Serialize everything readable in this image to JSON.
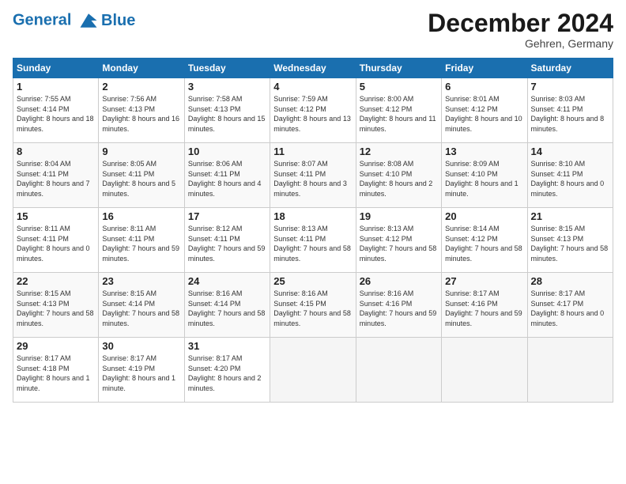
{
  "header": {
    "logo_line1": "General",
    "logo_line2": "Blue",
    "month": "December 2024",
    "location": "Gehren, Germany"
  },
  "days_of_week": [
    "Sunday",
    "Monday",
    "Tuesday",
    "Wednesday",
    "Thursday",
    "Friday",
    "Saturday"
  ],
  "weeks": [
    [
      {
        "day": 1,
        "sunrise": "7:55 AM",
        "sunset": "4:14 PM",
        "daylight": "8 hours and 18 minutes."
      },
      {
        "day": 2,
        "sunrise": "7:56 AM",
        "sunset": "4:13 PM",
        "daylight": "8 hours and 16 minutes."
      },
      {
        "day": 3,
        "sunrise": "7:58 AM",
        "sunset": "4:13 PM",
        "daylight": "8 hours and 15 minutes."
      },
      {
        "day": 4,
        "sunrise": "7:59 AM",
        "sunset": "4:12 PM",
        "daylight": "8 hours and 13 minutes."
      },
      {
        "day": 5,
        "sunrise": "8:00 AM",
        "sunset": "4:12 PM",
        "daylight": "8 hours and 11 minutes."
      },
      {
        "day": 6,
        "sunrise": "8:01 AM",
        "sunset": "4:12 PM",
        "daylight": "8 hours and 10 minutes."
      },
      {
        "day": 7,
        "sunrise": "8:03 AM",
        "sunset": "4:11 PM",
        "daylight": "8 hours and 8 minutes."
      }
    ],
    [
      {
        "day": 8,
        "sunrise": "8:04 AM",
        "sunset": "4:11 PM",
        "daylight": "8 hours and 7 minutes."
      },
      {
        "day": 9,
        "sunrise": "8:05 AM",
        "sunset": "4:11 PM",
        "daylight": "8 hours and 5 minutes."
      },
      {
        "day": 10,
        "sunrise": "8:06 AM",
        "sunset": "4:11 PM",
        "daylight": "8 hours and 4 minutes."
      },
      {
        "day": 11,
        "sunrise": "8:07 AM",
        "sunset": "4:11 PM",
        "daylight": "8 hours and 3 minutes."
      },
      {
        "day": 12,
        "sunrise": "8:08 AM",
        "sunset": "4:10 PM",
        "daylight": "8 hours and 2 minutes."
      },
      {
        "day": 13,
        "sunrise": "8:09 AM",
        "sunset": "4:10 PM",
        "daylight": "8 hours and 1 minute."
      },
      {
        "day": 14,
        "sunrise": "8:10 AM",
        "sunset": "4:11 PM",
        "daylight": "8 hours and 0 minutes."
      }
    ],
    [
      {
        "day": 15,
        "sunrise": "8:11 AM",
        "sunset": "4:11 PM",
        "daylight": "8 hours and 0 minutes."
      },
      {
        "day": 16,
        "sunrise": "8:11 AM",
        "sunset": "4:11 PM",
        "daylight": "7 hours and 59 minutes."
      },
      {
        "day": 17,
        "sunrise": "8:12 AM",
        "sunset": "4:11 PM",
        "daylight": "7 hours and 59 minutes."
      },
      {
        "day": 18,
        "sunrise": "8:13 AM",
        "sunset": "4:11 PM",
        "daylight": "7 hours and 58 minutes."
      },
      {
        "day": 19,
        "sunrise": "8:13 AM",
        "sunset": "4:12 PM",
        "daylight": "7 hours and 58 minutes."
      },
      {
        "day": 20,
        "sunrise": "8:14 AM",
        "sunset": "4:12 PM",
        "daylight": "7 hours and 58 minutes."
      },
      {
        "day": 21,
        "sunrise": "8:15 AM",
        "sunset": "4:13 PM",
        "daylight": "7 hours and 58 minutes."
      }
    ],
    [
      {
        "day": 22,
        "sunrise": "8:15 AM",
        "sunset": "4:13 PM",
        "daylight": "7 hours and 58 minutes."
      },
      {
        "day": 23,
        "sunrise": "8:15 AM",
        "sunset": "4:14 PM",
        "daylight": "7 hours and 58 minutes."
      },
      {
        "day": 24,
        "sunrise": "8:16 AM",
        "sunset": "4:14 PM",
        "daylight": "7 hours and 58 minutes."
      },
      {
        "day": 25,
        "sunrise": "8:16 AM",
        "sunset": "4:15 PM",
        "daylight": "7 hours and 58 minutes."
      },
      {
        "day": 26,
        "sunrise": "8:16 AM",
        "sunset": "4:16 PM",
        "daylight": "7 hours and 59 minutes."
      },
      {
        "day": 27,
        "sunrise": "8:17 AM",
        "sunset": "4:16 PM",
        "daylight": "7 hours and 59 minutes."
      },
      {
        "day": 28,
        "sunrise": "8:17 AM",
        "sunset": "4:17 PM",
        "daylight": "8 hours and 0 minutes."
      }
    ],
    [
      {
        "day": 29,
        "sunrise": "8:17 AM",
        "sunset": "4:18 PM",
        "daylight": "8 hours and 1 minute."
      },
      {
        "day": 30,
        "sunrise": "8:17 AM",
        "sunset": "4:19 PM",
        "daylight": "8 hours and 1 minute."
      },
      {
        "day": 31,
        "sunrise": "8:17 AM",
        "sunset": "4:20 PM",
        "daylight": "8 hours and 2 minutes."
      },
      null,
      null,
      null,
      null
    ]
  ]
}
